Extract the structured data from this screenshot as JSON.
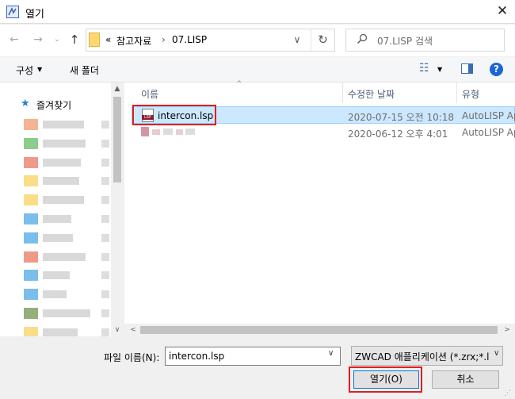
{
  "window": {
    "title": "열기",
    "close_glyph": "✕"
  },
  "nav": {
    "back_glyph": "←",
    "forward_glyph": "→",
    "recent_glyph": "⌄",
    "up_glyph": "↑",
    "breadcrumb": [
      "참고자료",
      "07.LISP"
    ],
    "breadcrumb_prefix": "«",
    "breadcrumb_sep": "›",
    "dropdown_glyph": "∨",
    "refresh_glyph": "↻",
    "search_placeholder": "07.LISP 검색"
  },
  "toolbar": {
    "organize_label": "구성",
    "new_folder_label": "새 폴더",
    "help_glyph": "?",
    "view_glyph": "☷",
    "dropdown_glyph": "▼"
  },
  "sidebar": {
    "favorites_label": "즐겨찾기",
    "star_glyph": "★",
    "up_glyph": "▲",
    "down_glyph": "∨",
    "items": [
      {
        "icon_color": "#f2a07a"
      },
      {
        "icon_color": "#6fbf6f"
      },
      {
        "icon_color": "#e8826a"
      },
      {
        "icon_color": "#f7d46b"
      },
      {
        "icon_color": "#f7d46b"
      },
      {
        "icon_color": "#5aaee6"
      },
      {
        "icon_color": "#5aaee6"
      },
      {
        "icon_color": "#e8826a"
      },
      {
        "icon_color": "#5aaee6"
      },
      {
        "icon_color": "#5aaee6"
      },
      {
        "icon_color": "#7a9a5a"
      },
      {
        "icon_color": "#f7d46b"
      }
    ]
  },
  "file_list": {
    "columns": [
      "이름",
      "수정한 날짜",
      "유형"
    ],
    "sort_glyph": "^",
    "rows": [
      {
        "name": "intercon.lsp",
        "modified": "2020-07-15 오전 10:18",
        "type": "AutoLISP Ap",
        "badge": "LSP",
        "selected": true
      },
      {
        "name": "",
        "modified": "2020-06-12 오후 4:01",
        "type": "AutoLISP Ap",
        "selected": false
      }
    ],
    "scroll_left_glyph": "<",
    "scroll_right_glyph": ">"
  },
  "footer": {
    "filename_label": "파일 이름(N):",
    "filename_value": "intercon.lsp",
    "combo_glyph": "∨",
    "filetype_value": "ZWCAD 애플리케이션 (*.zrx;*.l",
    "open_label": "열기(O)",
    "cancel_label": "취소",
    "grip_glyph": "⋰"
  },
  "colors": {
    "selection": "#cce8ff",
    "highlight_box": "#e11e1e",
    "accent": "#0078d7"
  }
}
